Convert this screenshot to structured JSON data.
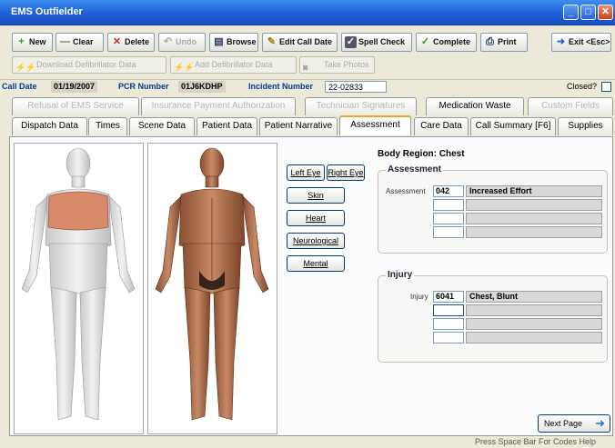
{
  "window": {
    "title": "EMS Outfielder"
  },
  "toolbar": [
    {
      "label": "New",
      "icon": "+",
      "icon_name": "plus-icon",
      "enabled": true
    },
    {
      "label": "Clear",
      "icon": "—",
      "icon_name": "clear-icon",
      "enabled": true
    },
    {
      "label": "Delete",
      "icon": "✕",
      "icon_name": "delete-icon",
      "enabled": true
    },
    {
      "label": "Undo",
      "icon": "↶",
      "icon_name": "undo-icon",
      "enabled": false
    },
    {
      "label": "Browse",
      "icon": "▤",
      "icon_name": "browse-icon",
      "enabled": true
    },
    {
      "label": "Edit Call Date",
      "icon": "✎",
      "icon_name": "pencil-icon",
      "enabled": true
    },
    {
      "label": "Spell Check",
      "icon": "✓",
      "icon_name": "spellcheck-icon",
      "enabled": true
    },
    {
      "label": "Complete",
      "icon": "✓",
      "icon_name": "check-icon",
      "enabled": true
    },
    {
      "label": "Print",
      "icon": "⎙",
      "icon_name": "printer-icon",
      "enabled": true
    },
    {
      "label": "Exit <Esc>",
      "icon": "➜",
      "icon_name": "exit-icon",
      "enabled": true
    }
  ],
  "toolbar2": [
    {
      "label": "Download Defibrillator Data",
      "icon_name": "defibrillator-icon"
    },
    {
      "label": "Add Defibrillator Data",
      "icon_name": "defibrillator-icon"
    },
    {
      "label": "Take Photos",
      "icon_name": "camera-icon"
    }
  ],
  "info": {
    "call_date_label": "Call Date",
    "call_date": "01/19/2007",
    "pcr_label": "PCR Number",
    "pcr": "01J6KDHP",
    "incident_label": "Incident Number",
    "incident": "22-02833",
    "closed_label": "Closed?"
  },
  "tabs_row1": [
    {
      "label": "Refusal of EMS Service",
      "enabled": false,
      "active": false
    },
    {
      "label": "Insurance Payment Authorization",
      "enabled": false,
      "active": false
    },
    {
      "label": "Technician Signatures",
      "enabled": false,
      "active": false
    },
    {
      "label": "Medication Waste",
      "enabled": true,
      "active": false
    },
    {
      "label": "Custom Fields",
      "enabled": false,
      "active": false
    }
  ],
  "tabs_row2": [
    {
      "label": "Dispatch Data",
      "active": false
    },
    {
      "label": "Times",
      "active": false
    },
    {
      "label": "Scene Data",
      "active": false
    },
    {
      "label": "Patient Data",
      "active": false
    },
    {
      "label": "Patient Narrative",
      "active": false
    },
    {
      "label": "Assessment",
      "active": true
    },
    {
      "label": "Care Data",
      "active": false
    },
    {
      "label": "Call Summary [F6]",
      "active": false
    },
    {
      "label": "Supplies",
      "active": false
    }
  ],
  "region_buttons": {
    "left_eye": "Left Eye",
    "right_eye": "Right Eye",
    "skin": "Skin",
    "heart": "Heart",
    "neuro": "Neurological",
    "mental": "Mental"
  },
  "body_region": {
    "label": "Body Region:",
    "value": "Chest"
  },
  "assessment": {
    "title": "Assessment",
    "field_label": "Assessment",
    "rows": [
      {
        "code": "042",
        "desc": "Increased Effort"
      },
      {
        "code": "",
        "desc": ""
      },
      {
        "code": "",
        "desc": ""
      },
      {
        "code": "",
        "desc": ""
      }
    ]
  },
  "injury": {
    "title": "Injury",
    "field_label": "Injury",
    "rows": [
      {
        "code": "6041",
        "desc": "Chest, Blunt"
      },
      {
        "code": "",
        "desc": ""
      },
      {
        "code": "",
        "desc": ""
      },
      {
        "code": "",
        "desc": ""
      }
    ]
  },
  "next_page": "Next Page",
  "status_text": "Press Space Bar For Codes Help",
  "colors": {
    "title_bar": "#1f5fd6",
    "chest_highlight": "#d98a6a",
    "active_tab_accent": "#f0a030"
  }
}
